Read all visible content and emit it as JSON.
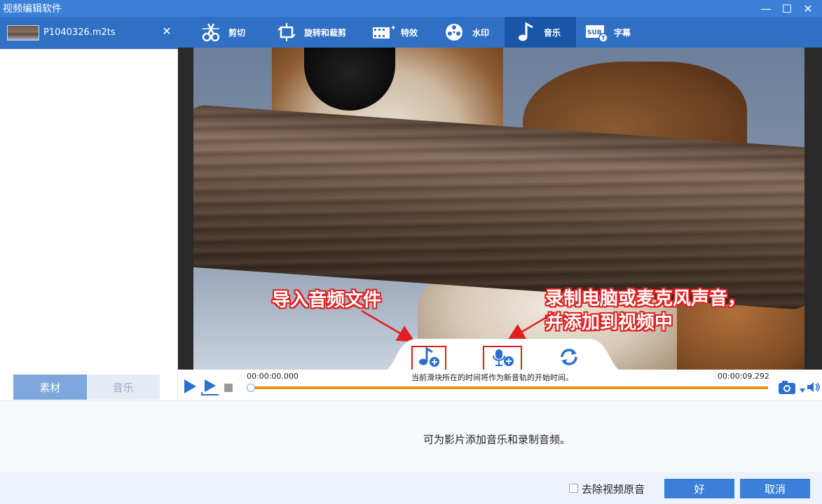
{
  "window": {
    "title": "视频编辑软件",
    "minimize": "—",
    "maximize": "☐",
    "close": "✕"
  },
  "file": {
    "name": "P1040326.m2ts",
    "close": "✕"
  },
  "left_tabs": [
    {
      "label": "素材"
    },
    {
      "label": "音乐"
    }
  ],
  "toolbar": {
    "tools": [
      {
        "label": "剪切",
        "icon": "scissors-icon"
      },
      {
        "label": "旋转和裁剪",
        "icon": "crop-rotate-icon"
      },
      {
        "label": "特效",
        "icon": "film-effects-icon"
      },
      {
        "label": "水印",
        "icon": "film-reel-icon"
      },
      {
        "label": "音乐",
        "icon": "music-note-icon",
        "active": true
      },
      {
        "label": "字幕",
        "icon": "subtitle-icon"
      }
    ]
  },
  "annotations": {
    "import_audio": "导入音频文件",
    "record_line1": "录制电脑或麦克风声音，",
    "record_line2": "并添加到视频中"
  },
  "playback": {
    "time_start": "00:00:00.000",
    "time_end": "00:00:09.292",
    "hint": "当前滑块所在的时间将作为新音轨的开始时间。",
    "position": 0.0
  },
  "info": {
    "text": "可为影片添加音乐和录制音频。"
  },
  "footer": {
    "checkbox_label": "去除视频原音",
    "checkbox_checked": false,
    "ok": "好",
    "cancel": "取消"
  },
  "colors": {
    "titlebar": "#3a80d8",
    "toolbar": "#2f6fc4",
    "toolbar_active": "#1a56a8",
    "icon_blue": "#2a6fcf",
    "timeline": "#f08b1b",
    "annotation_red": "#e02020"
  }
}
